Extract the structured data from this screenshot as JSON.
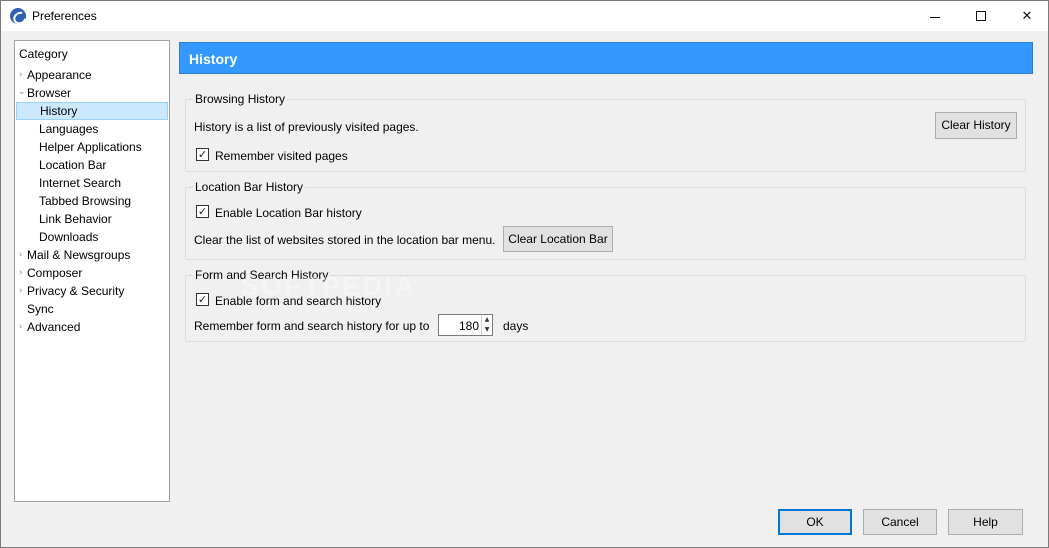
{
  "window": {
    "title": "Preferences",
    "controls": {
      "minimize": "minimize",
      "maximize": "maximize",
      "close": "✕"
    }
  },
  "category": {
    "header": "Category",
    "items": [
      {
        "label": "Appearance",
        "chevron": "›"
      },
      {
        "label": "Browser",
        "chevron": "⌄"
      },
      {
        "label": "History"
      },
      {
        "label": "Languages"
      },
      {
        "label": "Helper Applications"
      },
      {
        "label": "Location Bar"
      },
      {
        "label": "Internet Search"
      },
      {
        "label": "Tabbed Browsing"
      },
      {
        "label": "Link Behavior"
      },
      {
        "label": "Downloads"
      },
      {
        "label": "Mail & Newsgroups",
        "chevron": "›"
      },
      {
        "label": "Composer",
        "chevron": "›"
      },
      {
        "label": "Privacy & Security",
        "chevron": "›"
      },
      {
        "label": "Sync"
      },
      {
        "label": "Advanced",
        "chevron": "›"
      }
    ],
    "selected": "History"
  },
  "panel": {
    "title": "History",
    "header_color": "#3399ff"
  },
  "browsing_history": {
    "title": "Browsing History",
    "description": "History is a list of previously visited pages.",
    "clear_button": "Clear History",
    "remember_label": "Remember visited pages",
    "remember_checked": true
  },
  "location_bar_history": {
    "title": "Location Bar History",
    "enable_label": "Enable Location Bar history",
    "enable_checked": true,
    "description": "Clear the list of websites stored in the location bar menu.",
    "clear_button": "Clear Location Bar"
  },
  "form_history": {
    "title": "Form and Search History",
    "enable_label": "Enable form and search history",
    "enable_checked": true,
    "remember_prefix": "Remember form and search history for up to",
    "days_value": "180",
    "days_suffix": "days"
  },
  "footer": {
    "ok": "OK",
    "cancel": "Cancel",
    "help": "Help"
  },
  "icons": {
    "check": "✓",
    "spin_up": "▲",
    "spin_down": "▼"
  },
  "watermark": "SOFTPEDIA"
}
